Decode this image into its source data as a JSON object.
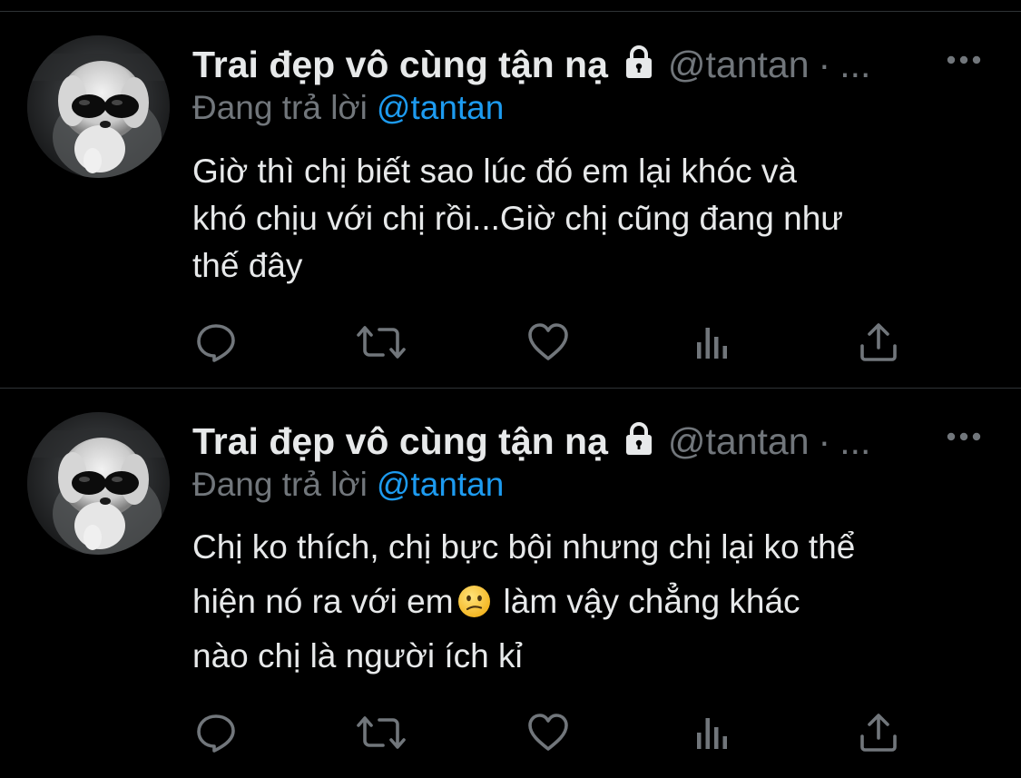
{
  "colors": {
    "background": "#000000",
    "text_primary": "#e7e9ea",
    "text_secondary": "#71767b",
    "accent_link": "#1d9bf0",
    "divider": "#2f3336"
  },
  "tweets": [
    {
      "display_name": "Trai đẹp vô cùng tận nạ",
      "lock_icon": "lock-icon",
      "handle": "@tantan",
      "separator": "·",
      "truncation": "...",
      "more_icon": "more-horizontal-icon",
      "reply_prefix": "Đang trả lời",
      "reply_mention": "@tantan",
      "text_lines": [
        "Giờ thì chị biết sao lúc đó em lại khóc và",
        "khó chịu với chị rồi...Giờ chị cũng đang như",
        "thế đây"
      ],
      "actions": [
        "reply-icon",
        "retweet-icon",
        "like-icon",
        "views-icon",
        "share-icon"
      ]
    },
    {
      "display_name": "Trai đẹp vô cùng tận nạ",
      "lock_icon": "lock-icon",
      "handle": "@tantan",
      "separator": "·",
      "truncation": "...",
      "more_icon": "more-horizontal-icon",
      "reply_prefix": "Đang trả lời",
      "reply_mention": "@tantan",
      "text_lines": [
        "Chị ko thích, chị bực bội nhưng chị lại ko thể",
        "hiện nó ra với em",
        "làm vậy chẳng khác",
        "nào chị là người ích kỉ"
      ],
      "emoji": "confused-face-emoji",
      "actions": [
        "reply-icon",
        "retweet-icon",
        "like-icon",
        "views-icon",
        "share-icon"
      ]
    }
  ]
}
